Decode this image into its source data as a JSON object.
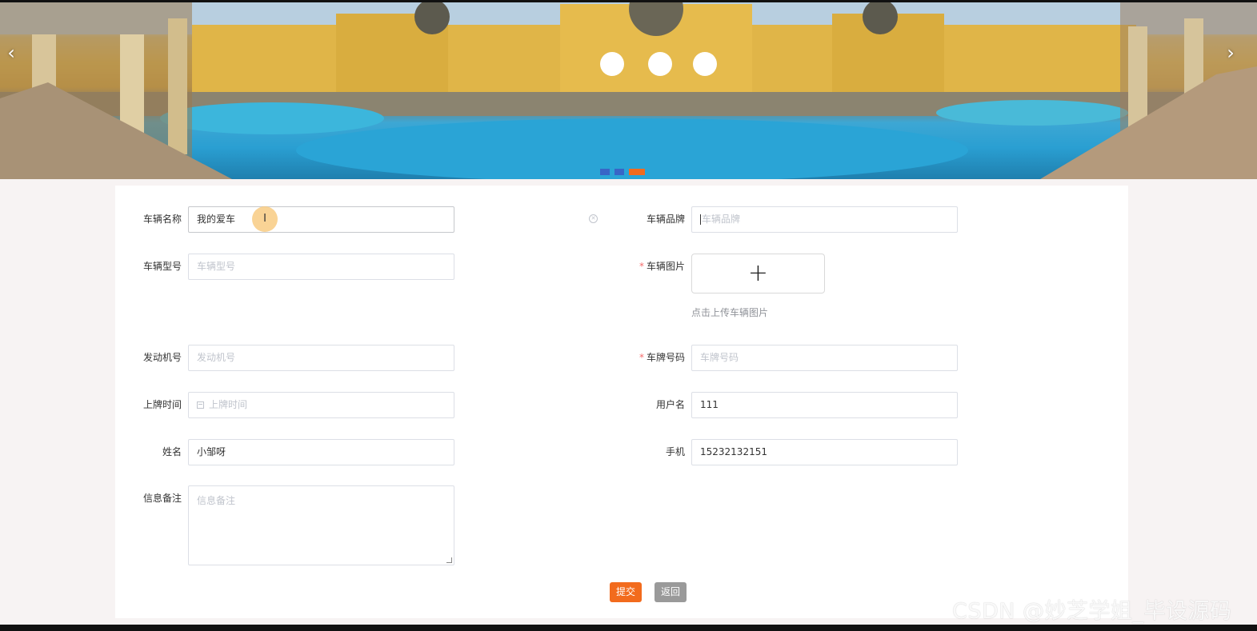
{
  "carousel": {
    "prev_icon": "chevron-left-icon",
    "next_icon": "chevron-right-icon",
    "prev_glyph": "‹",
    "next_glyph": "›",
    "slide_count": 3,
    "active_slide": 3
  },
  "form": {
    "vehicle_name": {
      "label": "车辆名称",
      "value": "我的爱车",
      "placeholder": ""
    },
    "vehicle_brand": {
      "label": "车辆品牌",
      "value": "",
      "placeholder": "车辆品牌"
    },
    "vehicle_model": {
      "label": "车辆型号",
      "value": "",
      "placeholder": "车辆型号"
    },
    "vehicle_image": {
      "label": "车辆图片",
      "required": true,
      "upload_icon": "plus-icon",
      "upload_glyph": "+",
      "tip": "点击上传车辆图片"
    },
    "engine_no": {
      "label": "发动机号",
      "value": "",
      "placeholder": "发动机号"
    },
    "plate_no": {
      "label": "车牌号码",
      "required": true,
      "value": "",
      "placeholder": "车牌号码"
    },
    "plate_date": {
      "label": "上牌时间",
      "value": "",
      "placeholder": "上牌时间",
      "icon": "calendar-icon"
    },
    "username": {
      "label": "用户名",
      "value": "111"
    },
    "name": {
      "label": "姓名",
      "value": "小邹呀"
    },
    "phone": {
      "label": "手机",
      "value": "15232132151"
    },
    "remark": {
      "label": "信息备注",
      "value": "",
      "placeholder": "信息备注"
    },
    "required_mark": "*"
  },
  "buttons": {
    "submit": "提交",
    "back": "返回"
  },
  "colors": {
    "accent": "#f26b1d",
    "back_button": "#9a9a9a",
    "required": "#f56c6c",
    "carousel_dot": "#3b5cc4"
  },
  "watermark": "CSDN @妙芝学姐_毕设源码"
}
